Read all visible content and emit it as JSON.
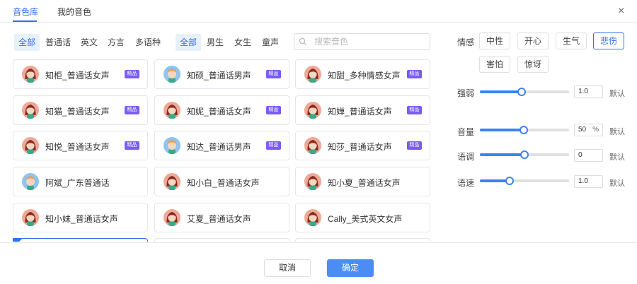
{
  "tabs": [
    {
      "label": "音色库",
      "active": true
    },
    {
      "label": "我的音色",
      "active": false
    }
  ],
  "close_label": "×",
  "language_filters": [
    {
      "label": "全部",
      "active": true
    },
    {
      "label": "普通话",
      "active": false
    },
    {
      "label": "英文",
      "active": false
    },
    {
      "label": "方言",
      "active": false
    },
    {
      "label": "多语种",
      "active": false
    }
  ],
  "gender_filters": [
    {
      "label": "全部",
      "active": true
    },
    {
      "label": "男生",
      "active": false
    },
    {
      "label": "女生",
      "active": false
    },
    {
      "label": "童声",
      "active": false
    }
  ],
  "search": {
    "placeholder": "搜索音色",
    "value": ""
  },
  "voices": [
    {
      "name": "知柜_普通话女声",
      "badge": "精品",
      "avatar": "female"
    },
    {
      "name": "知硕_普通话男声",
      "badge": "精品",
      "avatar": "male"
    },
    {
      "name": "知甜_多种情感女声",
      "badge": "精品",
      "avatar": "female"
    },
    {
      "name": "知猫_普通话女声",
      "badge": "精品",
      "avatar": "female"
    },
    {
      "name": "知妮_普通话女声",
      "badge": "精品",
      "avatar": "female"
    },
    {
      "name": "知婵_普通话女声",
      "badge": "精品",
      "avatar": "female"
    },
    {
      "name": "知悦_普通话女声",
      "badge": "精品",
      "avatar": "female"
    },
    {
      "name": "知达_普通话男声",
      "badge": "精品",
      "avatar": "male"
    },
    {
      "name": "知莎_普通话女声",
      "badge": "精品",
      "avatar": "female"
    },
    {
      "name": "阿斌_广东普通话",
      "badge": "",
      "avatar": "male"
    },
    {
      "name": "知小白_普通话女声",
      "badge": "",
      "avatar": "female"
    },
    {
      "name": "知小夏_普通话女声",
      "badge": "",
      "avatar": "female"
    },
    {
      "name": "知小妹_普通话女声",
      "badge": "",
      "avatar": "female"
    },
    {
      "name": "艾夏_普通话女声",
      "badge": "",
      "avatar": "female"
    },
    {
      "name": "Cally_美式英文女声",
      "badge": "",
      "avatar": "female"
    },
    {
      "name": "",
      "badge": "",
      "avatar": "none",
      "selected": true
    },
    {
      "name": "",
      "badge": "",
      "avatar": "none"
    },
    {
      "name": "",
      "badge": "",
      "avatar": "none"
    }
  ],
  "emotion": {
    "label": "情感",
    "options": [
      {
        "label": "中性",
        "active": false
      },
      {
        "label": "开心",
        "active": false
      },
      {
        "label": "生气",
        "active": false
      },
      {
        "label": "悲伤",
        "active": true
      },
      {
        "label": "害怕",
        "active": false
      },
      {
        "label": "惊讶",
        "active": false
      }
    ]
  },
  "sliders": [
    {
      "label": "强弱",
      "value_text": "1.0",
      "unit": "",
      "fraction": 0.47,
      "default_label": "默认"
    },
    {
      "label": "音量",
      "value_text": "50",
      "unit": "%",
      "fraction": 0.49,
      "default_label": "默认"
    },
    {
      "label": "语调",
      "value_text": "0",
      "unit": "",
      "fraction": 0.5,
      "default_label": "默认"
    },
    {
      "label": "语速",
      "value_text": "1.0",
      "unit": "",
      "fraction": 0.33,
      "default_label": "默认"
    }
  ],
  "footer": {
    "cancel_label": "取消",
    "ok_label": "确定"
  },
  "colors": {
    "accent": "#2f6ff2",
    "badge": "#7b5cf5",
    "primary_button": "#4c8cf5"
  }
}
